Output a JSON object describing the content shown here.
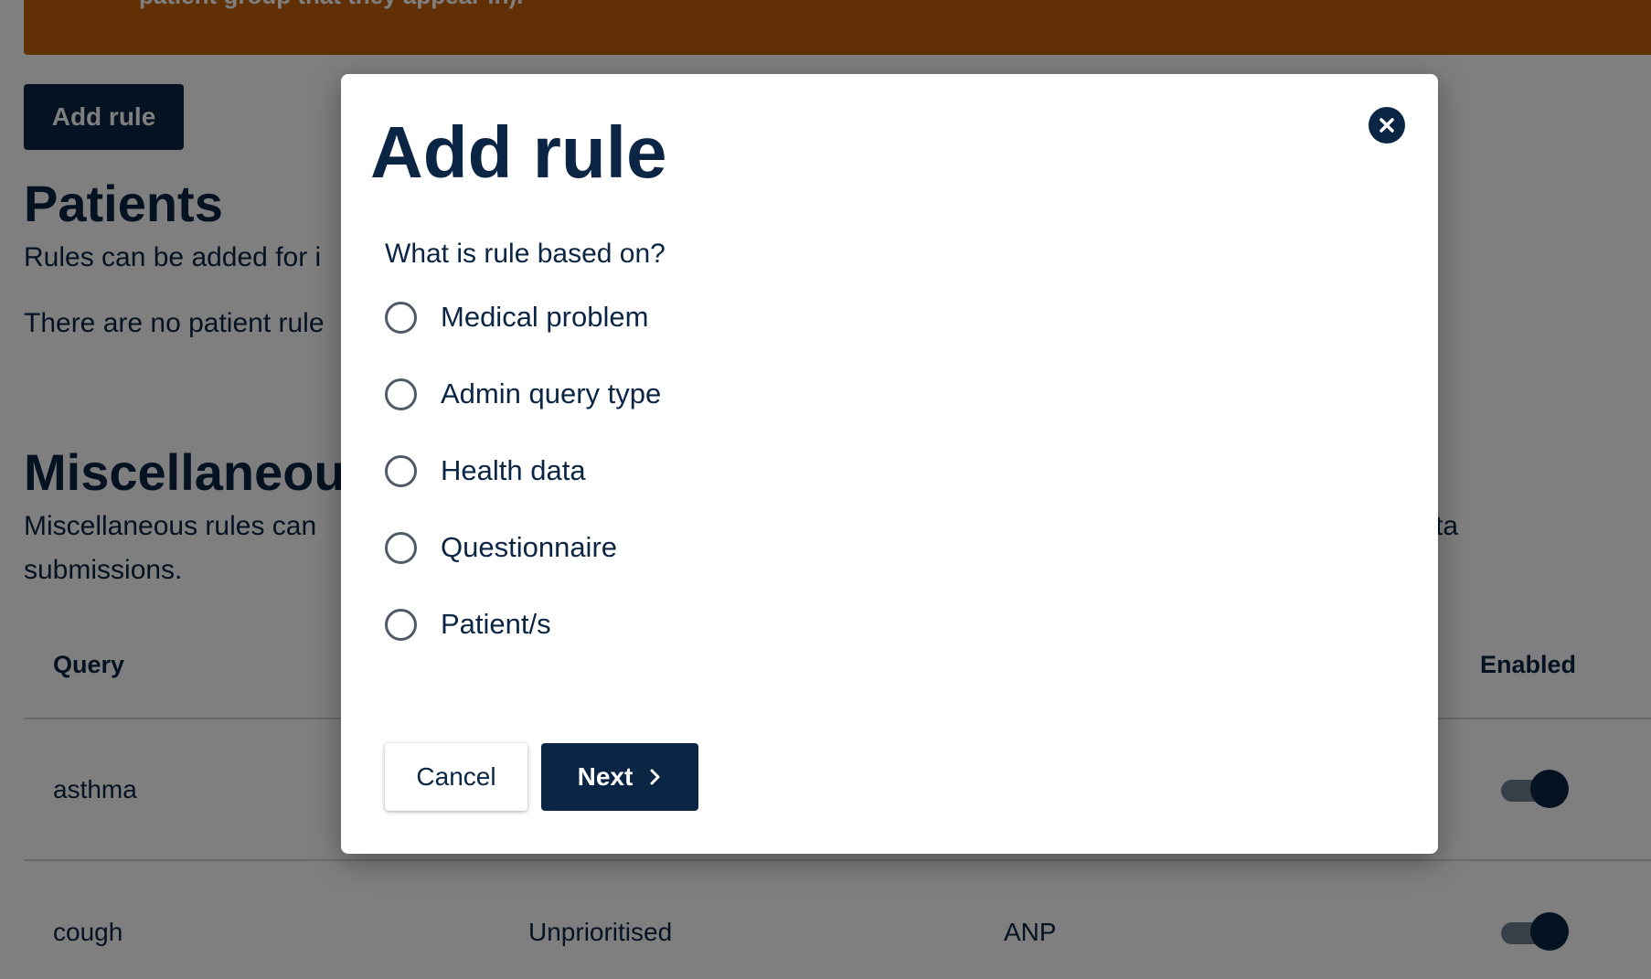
{
  "banner": {
    "text": "patient group that they appear in)."
  },
  "page": {
    "add_rule_button": "Add rule",
    "patients": {
      "heading": "Patients",
      "description": "Rules can be added for i",
      "empty_text": "There are no patient rule"
    },
    "misc": {
      "heading": "Miscellaneous",
      "description_line1": "Miscellaneous rules can",
      "description_line1_right": "ta",
      "description_line2": "submissions."
    },
    "table": {
      "columns": {
        "query": "Query",
        "enabled": "Enabled"
      },
      "rows": [
        {
          "query": "asthma",
          "priority": "",
          "assignee": "",
          "enabled": true
        },
        {
          "query": "cough",
          "priority": "Unprioritised",
          "assignee": "ANP",
          "enabled": true
        }
      ]
    }
  },
  "modal": {
    "title": "Add rule",
    "close_icon": "close-icon",
    "question": "What is rule based on?",
    "options": [
      {
        "label": "Medical problem",
        "selected": false
      },
      {
        "label": "Admin query type",
        "selected": false
      },
      {
        "label": "Health data",
        "selected": false
      },
      {
        "label": "Questionnaire",
        "selected": false
      },
      {
        "label": "Patient/s",
        "selected": false
      }
    ],
    "cancel_label": "Cancel",
    "next_label": "Next",
    "next_icon": "chevron-right-icon"
  },
  "colors": {
    "primary": "#0b2545",
    "banner": "#c2600a",
    "overlay": "rgba(0,0,0,0.5)"
  }
}
